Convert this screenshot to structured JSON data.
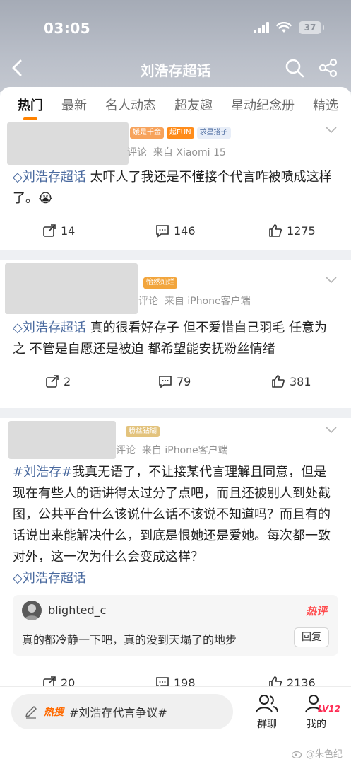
{
  "status": {
    "time": "03:05",
    "battery": "37"
  },
  "nav": {
    "title": "刘浩存超话"
  },
  "tabs": [
    {
      "label": "热门"
    },
    {
      "label": "最新"
    },
    {
      "label": "名人动态"
    },
    {
      "label": "超友趣"
    },
    {
      "label": "星动纪念册"
    },
    {
      "label": "精选"
    }
  ],
  "posts": [
    {
      "badges": [
        "媛是千金",
        "超FUN",
        "求星搭子"
      ],
      "meta_prefix": "评论",
      "meta_source": "来自 Xiaomi 15",
      "topic": "刘浩存超话",
      "text": " 太吓人了我还是不懂接个代言咋被喷成这样了。😭",
      "repost": "14",
      "comment": "146",
      "like": "1275"
    },
    {
      "badges": [
        "怡然灿烂"
      ],
      "meta_prefix": "评论",
      "meta_source": "来自 iPhone客户端",
      "topic": "刘浩存超话",
      "text": "  真的很看好存子 但不爱惜自己羽毛 任意为之 不管是自愿还是被迫 都希望能安抚粉丝情绪",
      "repost": "2",
      "comment": "79",
      "like": "381"
    },
    {
      "badges": [
        "粉丝钻瑚"
      ],
      "meta_prefix": "评论",
      "meta_source": "来自 iPhone客户端",
      "topic_hash": "#刘浩存#",
      "text": "我真无语了，不让接某代言理解且同意，但是现在有些人的话讲得太过分了点吧，而且还被别人到处截图，公共平台什么该说什么话不该说不知道吗？而且有的话说出来能解决什么，到底是恨她还是爱她。每次都一致对外，这一次为什么会变成这样？",
      "topic": "刘浩存超话",
      "hot_comment": {
        "user": "blighted_c",
        "tag": "热评",
        "text": "真的都冷静一下吧，真的没到天塌了的地步",
        "reply": "回复"
      },
      "repost": "20",
      "comment": "198",
      "like": "2136"
    }
  ],
  "bottom": {
    "hot_label": "热搜",
    "hot_text": "#刘浩存代言争议#",
    "group_chat": "群聊",
    "mine": "我的",
    "level": "LV12",
    "watermark": "@朱色纪"
  }
}
